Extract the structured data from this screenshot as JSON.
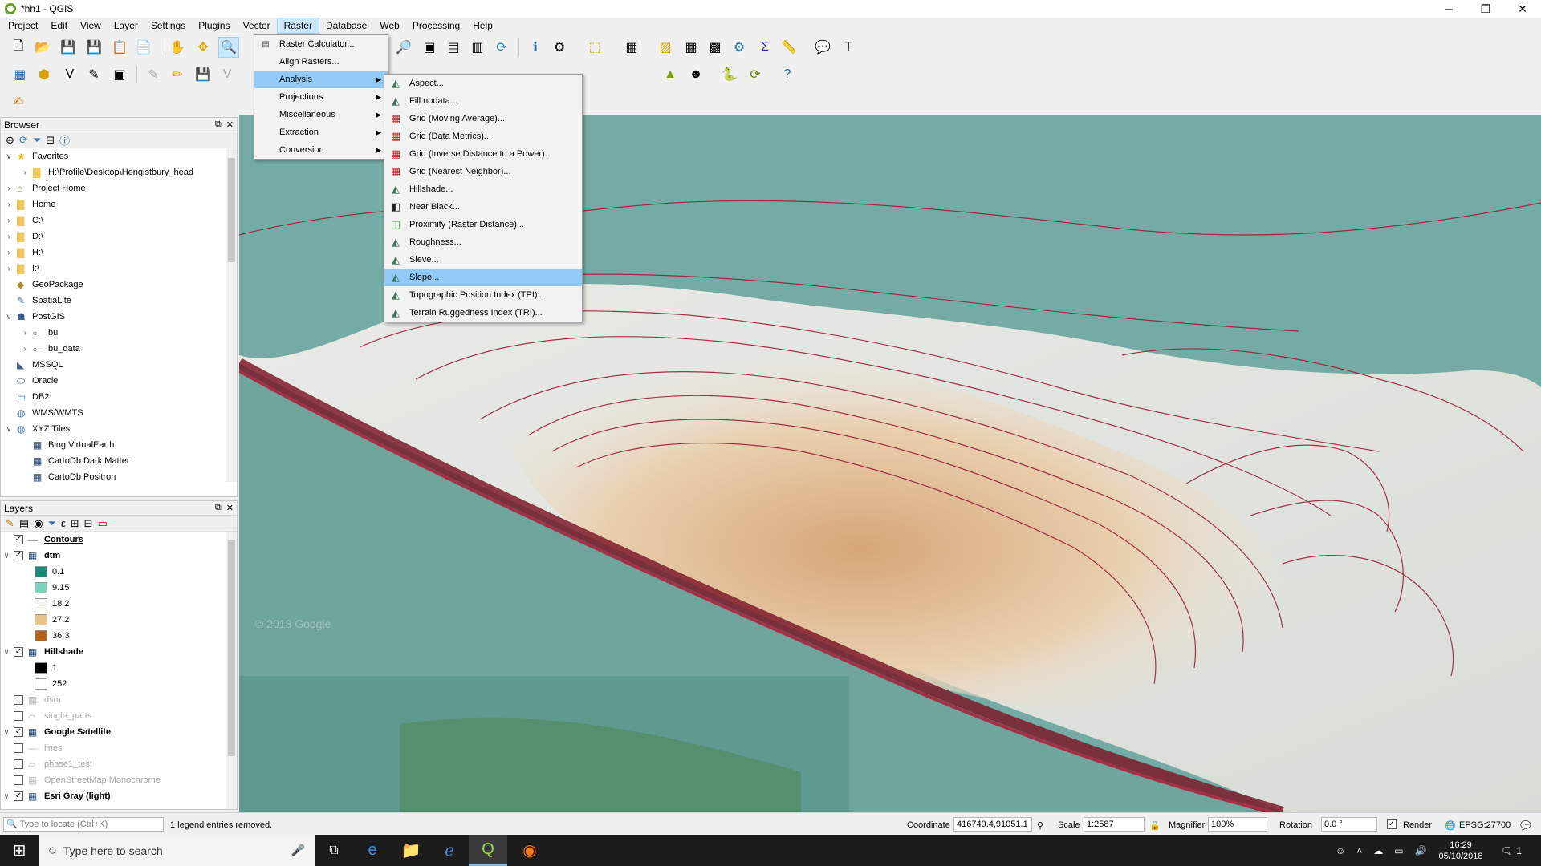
{
  "window": {
    "title": "*hh1 - QGIS",
    "min": "─",
    "max": "❐",
    "close": "✕"
  },
  "menubar": [
    "Project",
    "Edit",
    "View",
    "Layer",
    "Settings",
    "Plugins",
    "Vector",
    "Raster",
    "Database",
    "Web",
    "Processing",
    "Help"
  ],
  "raster_menu": {
    "items": [
      {
        "label": "Raster Calculator...",
        "icon": "calculator-icon",
        "submenu": false
      },
      {
        "label": "Align Rasters...",
        "icon": "",
        "submenu": false
      },
      {
        "label": "Analysis",
        "icon": "",
        "submenu": true,
        "highlighted": true
      },
      {
        "label": "Projections",
        "icon": "",
        "submenu": true
      },
      {
        "label": "Miscellaneous",
        "icon": "",
        "submenu": true
      },
      {
        "label": "Extraction",
        "icon": "",
        "submenu": true
      },
      {
        "label": "Conversion",
        "icon": "",
        "submenu": true
      }
    ]
  },
  "analysis_menu": {
    "items": [
      {
        "label": "Aspect...",
        "icon": "gdal-icon"
      },
      {
        "label": "Fill nodata...",
        "icon": "gdal-icon"
      },
      {
        "label": "Grid (Moving Average)...",
        "icon": "grid-icon"
      },
      {
        "label": "Grid (Data Metrics)...",
        "icon": "grid-icon"
      },
      {
        "label": "Grid (Inverse Distance to a Power)...",
        "icon": "grid-icon"
      },
      {
        "label": "Grid (Nearest Neighbor)...",
        "icon": "grid-icon"
      },
      {
        "label": "Hillshade...",
        "icon": "gdal-icon"
      },
      {
        "label": "Near Black...",
        "icon": "nearblack-icon"
      },
      {
        "label": "Proximity (Raster Distance)...",
        "icon": "proximity-icon"
      },
      {
        "label": "Roughness...",
        "icon": "gdal-icon"
      },
      {
        "label": "Sieve...",
        "icon": "gdal-icon"
      },
      {
        "label": "Slope...",
        "icon": "gdal-icon",
        "highlighted": true
      },
      {
        "label": "Topographic Position Index (TPI)...",
        "icon": "gdal-icon"
      },
      {
        "label": "Terrain Ruggedness Index (TRI)...",
        "icon": "gdal-icon"
      }
    ]
  },
  "browser": {
    "title": "Browser",
    "items": [
      {
        "label": "Favorites",
        "level": 0,
        "expander": "∨",
        "icon": "star-icon"
      },
      {
        "label": "H:\\Profile\\Desktop\\Hengistbury_head",
        "level": 1,
        "expander": "›",
        "icon": "folder-icon"
      },
      {
        "label": "Project Home",
        "level": 0,
        "expander": "›",
        "icon": "project-home-icon"
      },
      {
        "label": "Home",
        "level": 0,
        "expander": "›",
        "icon": "folder-icon"
      },
      {
        "label": "C:\\",
        "level": 0,
        "expander": "›",
        "icon": "folder-icon"
      },
      {
        "label": "D:\\",
        "level": 0,
        "expander": "›",
        "icon": "folder-icon"
      },
      {
        "label": "H:\\",
        "level": 0,
        "expander": "›",
        "icon": "folder-icon"
      },
      {
        "label": "I:\\",
        "level": 0,
        "expander": "›",
        "icon": "folder-icon"
      },
      {
        "label": "GeoPackage",
        "level": 0,
        "expander": "",
        "icon": "geopackage-icon"
      },
      {
        "label": "SpatiaLite",
        "level": 0,
        "expander": "",
        "icon": "spatialite-icon"
      },
      {
        "label": "PostGIS",
        "level": 0,
        "expander": "∨",
        "icon": "postgis-icon"
      },
      {
        "label": "bu",
        "level": 1,
        "expander": "›",
        "icon": "connection-icon"
      },
      {
        "label": "bu_data",
        "level": 1,
        "expander": "›",
        "icon": "connection-icon"
      },
      {
        "label": "MSSQL",
        "level": 0,
        "expander": "",
        "icon": "mssql-icon"
      },
      {
        "label": "Oracle",
        "level": 0,
        "expander": "",
        "icon": "oracle-icon"
      },
      {
        "label": "DB2",
        "level": 0,
        "expander": "",
        "icon": "db2-icon"
      },
      {
        "label": "WMS/WMTS",
        "level": 0,
        "expander": "",
        "icon": "wms-icon"
      },
      {
        "label": "XYZ Tiles",
        "level": 0,
        "expander": "∨",
        "icon": "xyz-icon"
      },
      {
        "label": "Bing VirtualEarth",
        "level": 1,
        "expander": "",
        "icon": "tile-icon"
      },
      {
        "label": "CartoDb Dark Matter",
        "level": 1,
        "expander": "",
        "icon": "tile-icon"
      },
      {
        "label": "CartoDb Positron",
        "level": 1,
        "expander": "",
        "icon": "tile-icon"
      }
    ]
  },
  "layers": {
    "title": "Layers",
    "rows": [
      {
        "kind": "layer",
        "label": "Contours",
        "checked": true,
        "expander": "",
        "bold": true,
        "underline": true,
        "dim": false,
        "icon": "line-layer-icon"
      },
      {
        "kind": "layer",
        "label": "dtm",
        "checked": true,
        "expander": "∨",
        "bold": true,
        "dim": false,
        "icon": "raster-layer-icon"
      },
      {
        "kind": "legend",
        "label": "0.1",
        "color": "#1a8a78"
      },
      {
        "kind": "legend",
        "label": "9.15",
        "color": "#7fd1c0"
      },
      {
        "kind": "legend",
        "label": "18.2",
        "color": "#f6f6f0"
      },
      {
        "kind": "legend",
        "label": "27.2",
        "color": "#e6c48a"
      },
      {
        "kind": "legend",
        "label": "36.3",
        "color": "#b2641c"
      },
      {
        "kind": "layer",
        "label": "Hillshade",
        "checked": true,
        "expander": "∨",
        "bold": true,
        "dim": false,
        "icon": "raster-layer-icon"
      },
      {
        "kind": "legend",
        "label": "1",
        "color": "#000000"
      },
      {
        "kind": "legend",
        "label": "252",
        "color": "#ffffff"
      },
      {
        "kind": "layer",
        "label": "dsm",
        "checked": false,
        "expander": "",
        "bold": false,
        "dim": true,
        "icon": "raster-layer-icon"
      },
      {
        "kind": "layer",
        "label": "single_parts",
        "checked": false,
        "expander": "",
        "bold": false,
        "dim": true,
        "icon": "polygon-layer-icon"
      },
      {
        "kind": "layer",
        "label": "Google Satellite",
        "checked": true,
        "expander": "∨",
        "bold": true,
        "dim": false,
        "icon": "raster-layer-icon"
      },
      {
        "kind": "layer",
        "label": "lines",
        "checked": false,
        "expander": "",
        "bold": false,
        "dim": true,
        "icon": "line-layer-icon"
      },
      {
        "kind": "layer",
        "label": "phase1_test",
        "checked": false,
        "expander": "",
        "bold": false,
        "dim": true,
        "icon": "polygon-layer-icon"
      },
      {
        "kind": "layer",
        "label": "OpenStreetMap Monochrome",
        "checked": false,
        "expander": "",
        "bold": false,
        "dim": true,
        "icon": "raster-layer-icon"
      },
      {
        "kind": "layer",
        "label": "Esri Gray (light)",
        "checked": true,
        "expander": "∨",
        "bold": true,
        "dim": false,
        "icon": "raster-layer-icon"
      }
    ]
  },
  "map": {
    "watermark": "© 2018 Google"
  },
  "statusbar": {
    "locate_placeholder": "Type to locate (Ctrl+K)",
    "message": "1 legend entries removed.",
    "coordinate_label": "Coordinate",
    "coordinate_value": "416749.4,91051.1",
    "scale_label": "Scale",
    "scale_value": "1:2587",
    "magnifier_label": "Magnifier",
    "magnifier_value": "100%",
    "rotation_label": "Rotation",
    "rotation_value": "0.0 °",
    "render_label": "Render",
    "render_checked": true,
    "crs": "EPSG:27700"
  },
  "taskbar": {
    "search_placeholder": "Type here to search",
    "time": "16:29",
    "date": "05/10/2018",
    "notifications": "1"
  }
}
